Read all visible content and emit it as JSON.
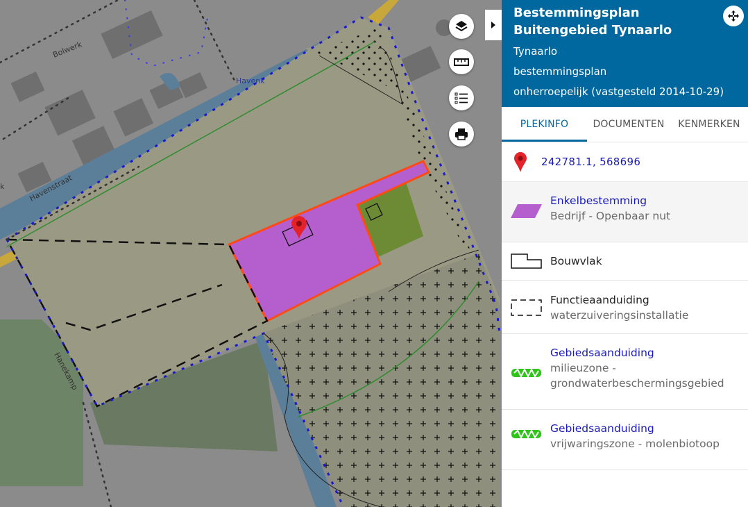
{
  "map": {
    "street_labels": [
      "Bolwerk",
      "Havenk",
      "Havenstraat",
      "Hanekamp",
      "k"
    ],
    "buttons": [
      "layers-icon",
      "ruler-icon",
      "legend-icon",
      "print-icon"
    ],
    "colors": {
      "basemap": "#8a8a8a",
      "agrarian": "#9a9a84",
      "enkelbestemming": "#b55fcf",
      "selection_outline": "#ff4a16",
      "groen": "#6d8a34",
      "water": "#5c7f99",
      "boundary": "#1a1acc"
    }
  },
  "panel": {
    "title": "Bestemmingsplan Buitengebied Tynaarlo",
    "municipality": "Tynaarlo",
    "plan_type": "bestemmingsplan",
    "status": "onherroepelijk (vastgesteld 2014-10-29)",
    "tabs": [
      {
        "label": "PLEKINFO",
        "active": true
      },
      {
        "label": "DOCUMENTEN",
        "active": false
      },
      {
        "label": "KENMERKEN",
        "active": false
      }
    ],
    "coordinates": "242781.1, 568696",
    "items": [
      {
        "title": "Enkelbestemming",
        "subtitle": "Bedrijf - Openbaar nut",
        "symbol": "purple-parallelogram-icon"
      },
      {
        "title": "Bouwvlak",
        "subtitle": "",
        "symbol": "bouwvlak-outline-icon"
      },
      {
        "title": "Functieaanduiding",
        "subtitle": "waterzuiveringsinstallatie",
        "symbol": "dashed-box-icon"
      },
      {
        "title": "Gebiedsaanduiding",
        "subtitle": "milieuzone - grondwaterbeschermingsgebied",
        "symbol": "green-zigzag-icon"
      },
      {
        "title": "Gebiedsaanduiding",
        "subtitle": "vrijwaringszone - molenbiotoop",
        "symbol": "green-zigzag-icon"
      }
    ]
  }
}
